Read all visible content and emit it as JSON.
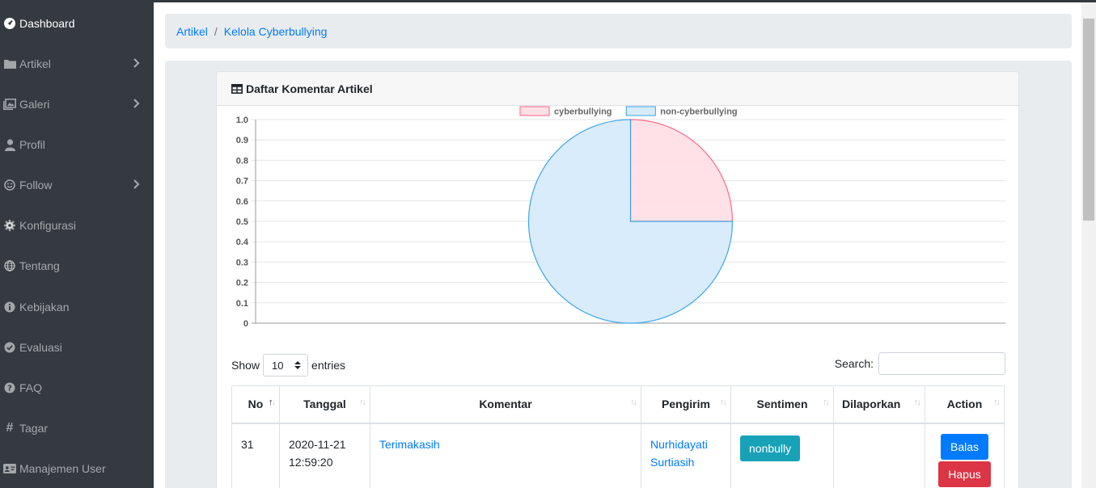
{
  "sidebar": {
    "items": [
      {
        "label": "Dashboard",
        "icon": "dashboard-icon",
        "active": true
      },
      {
        "label": "Artikel",
        "icon": "folder-icon",
        "chevron": true
      },
      {
        "label": "Galeri",
        "icon": "images-icon",
        "chevron": true
      },
      {
        "label": "Profil",
        "icon": "user-icon"
      },
      {
        "label": "Follow",
        "icon": "smile-icon",
        "chevron": true
      },
      {
        "label": "Konfigurasi",
        "icon": "cog-icon"
      },
      {
        "label": "Tentang",
        "icon": "globe-icon"
      },
      {
        "label": "Kebijakan",
        "icon": "info-icon"
      },
      {
        "label": "Evaluasi",
        "icon": "check-circle-icon"
      },
      {
        "label": "FAQ",
        "icon": "question-circle-icon"
      },
      {
        "label": "Tagar",
        "icon": "hashtag-icon"
      },
      {
        "label": "Manajemen User",
        "icon": "id-card-icon"
      }
    ]
  },
  "breadcrumb": {
    "items": [
      "Artikel",
      "Kelola Cyberbullying"
    ],
    "separator": "/"
  },
  "card": {
    "title": "Daftar Komentar Artikel"
  },
  "chart_data": {
    "type": "pie",
    "labels": [
      "cyberbullying",
      "non-cyberbullying"
    ],
    "values": [
      0.25,
      0.75
    ],
    "colors": [
      "#ffe0e6",
      "#d7ecfb"
    ],
    "borders": [
      "#ff6384",
      "#36a2eb"
    ],
    "yticks": [
      "1.0",
      "0.9",
      "0.8",
      "0.7",
      "0.6",
      "0.5",
      "0.4",
      "0.3",
      "0.2",
      "0.1",
      "0"
    ],
    "ylim": [
      0,
      1
    ],
    "legend": "top"
  },
  "datatable": {
    "show_label": "Show",
    "length_value": "10",
    "entries_label": "entries",
    "search_label": "Search:",
    "columns": [
      "No",
      "Tanggal",
      "Komentar",
      "Pengirim",
      "Sentimen",
      "Dilaporkan",
      "Action"
    ],
    "rows": [
      {
        "no": "31",
        "tanggal_line1": "2020-11-21",
        "tanggal_line2": "12:59:20",
        "komentar": "Terimakasih",
        "pengirim_line1": "Nurhidayati",
        "pengirim_line2": "Surtiasih",
        "sentimen": "nonbully",
        "dilaporkan": "",
        "action_reply": "Balas",
        "action_delete": "Hapus"
      }
    ]
  }
}
